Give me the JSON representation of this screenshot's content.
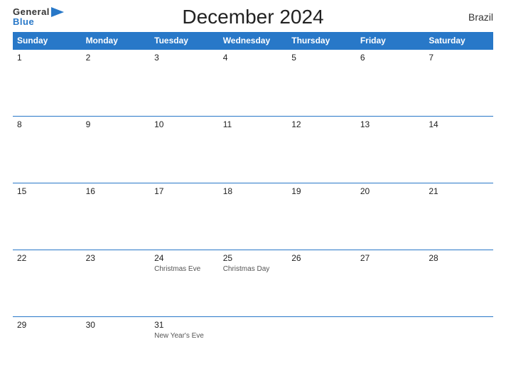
{
  "header": {
    "logo_general": "General",
    "logo_blue": "Blue",
    "title": "December 2024",
    "country": "Brazil"
  },
  "days_of_week": [
    "Sunday",
    "Monday",
    "Tuesday",
    "Wednesday",
    "Thursday",
    "Friday",
    "Saturday"
  ],
  "weeks": [
    [
      {
        "date": "1",
        "holiday": ""
      },
      {
        "date": "2",
        "holiday": ""
      },
      {
        "date": "3",
        "holiday": ""
      },
      {
        "date": "4",
        "holiday": ""
      },
      {
        "date": "5",
        "holiday": ""
      },
      {
        "date": "6",
        "holiday": ""
      },
      {
        "date": "7",
        "holiday": ""
      }
    ],
    [
      {
        "date": "8",
        "holiday": ""
      },
      {
        "date": "9",
        "holiday": ""
      },
      {
        "date": "10",
        "holiday": ""
      },
      {
        "date": "11",
        "holiday": ""
      },
      {
        "date": "12",
        "holiday": ""
      },
      {
        "date": "13",
        "holiday": ""
      },
      {
        "date": "14",
        "holiday": ""
      }
    ],
    [
      {
        "date": "15",
        "holiday": ""
      },
      {
        "date": "16",
        "holiday": ""
      },
      {
        "date": "17",
        "holiday": ""
      },
      {
        "date": "18",
        "holiday": ""
      },
      {
        "date": "19",
        "holiday": ""
      },
      {
        "date": "20",
        "holiday": ""
      },
      {
        "date": "21",
        "holiday": ""
      }
    ],
    [
      {
        "date": "22",
        "holiday": ""
      },
      {
        "date": "23",
        "holiday": ""
      },
      {
        "date": "24",
        "holiday": "Christmas Eve"
      },
      {
        "date": "25",
        "holiday": "Christmas Day"
      },
      {
        "date": "26",
        "holiday": ""
      },
      {
        "date": "27",
        "holiday": ""
      },
      {
        "date": "28",
        "holiday": ""
      }
    ],
    [
      {
        "date": "29",
        "holiday": ""
      },
      {
        "date": "30",
        "holiday": ""
      },
      {
        "date": "31",
        "holiday": "New Year's Eve"
      },
      {
        "date": "",
        "holiday": ""
      },
      {
        "date": "",
        "holiday": ""
      },
      {
        "date": "",
        "holiday": ""
      },
      {
        "date": "",
        "holiday": ""
      }
    ]
  ]
}
